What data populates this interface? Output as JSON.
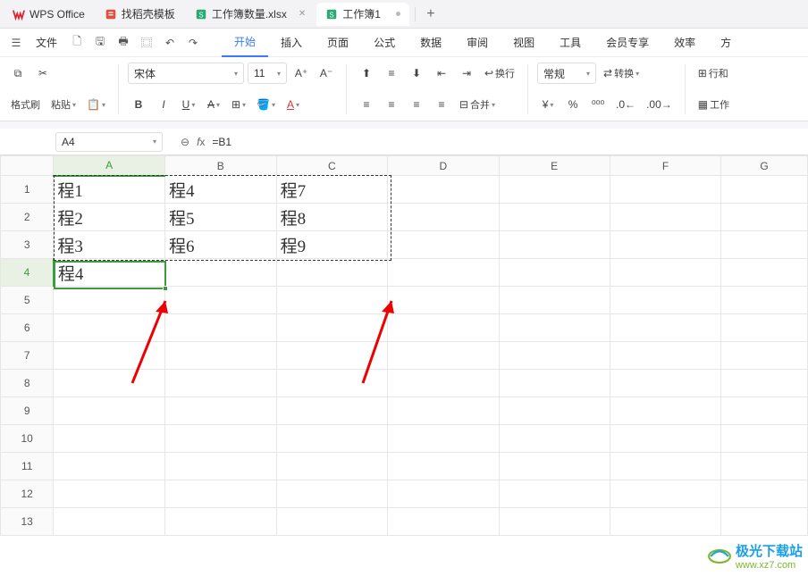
{
  "tabs": {
    "app": "WPS Office",
    "items": [
      {
        "label": "找稻壳模板",
        "icon": "template",
        "close": true
      },
      {
        "label": "工作簿数量.xlsx",
        "icon": "sheet",
        "close": true
      },
      {
        "label": "工作簿1",
        "icon": "sheet",
        "dot": true,
        "active": true
      }
    ],
    "add": "+"
  },
  "menubar": {
    "file": "文件",
    "menus": [
      "开始",
      "插入",
      "页面",
      "公式",
      "数据",
      "审阅",
      "视图",
      "工具",
      "会员专享",
      "效率",
      "方"
    ],
    "active_index": 0
  },
  "ribbon": {
    "paste_brush": "格式刷",
    "paste": "粘贴",
    "font_name": "宋体",
    "font_size": "11",
    "wrap": "换行",
    "merge": "合并",
    "number_format": "常规",
    "convert": "转换",
    "row_col": "行和",
    "worksheet": "工作"
  },
  "formula_bar": {
    "name_box": "A4",
    "formula": "=B1"
  },
  "grid": {
    "columns": [
      "A",
      "B",
      "C",
      "D",
      "E",
      "F",
      "G"
    ],
    "rows": [
      1,
      2,
      3,
      4,
      5,
      6,
      7,
      8,
      9,
      10,
      11,
      12,
      13
    ],
    "cells": {
      "A1": "程1",
      "B1": "程4",
      "C1": "程7",
      "A2": "程2",
      "B2": "程5",
      "C2": "程8",
      "A3": "程3",
      "B3": "程6",
      "C3": "程9",
      "A4": "程4"
    },
    "active_cell": "A4",
    "marquee_range": "A1:C3"
  },
  "watermark": {
    "title": "极光下载站",
    "url": "www.xz7.com"
  }
}
